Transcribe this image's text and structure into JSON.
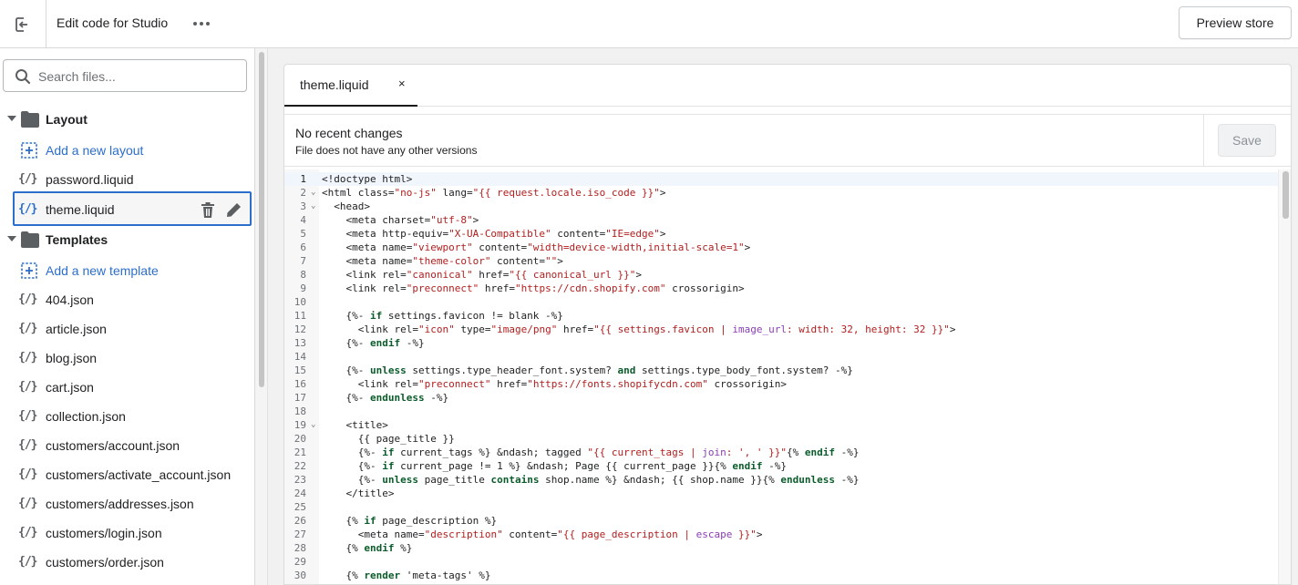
{
  "topbar": {
    "title": "Edit code for Studio",
    "preview_label": "Preview store",
    "more_label": "•••"
  },
  "sidebar": {
    "search_placeholder": "Search files...",
    "layout_folder": "Layout",
    "add_layout": "Add a new layout",
    "layout_files": [
      "password.liquid",
      "theme.liquid"
    ],
    "templates_folder": "Templates",
    "add_template": "Add a new template",
    "template_files": [
      "404.json",
      "article.json",
      "blog.json",
      "cart.json",
      "collection.json",
      "customers/account.json",
      "customers/activate_account.json",
      "customers/addresses.json",
      "customers/login.json",
      "customers/order.json"
    ],
    "file_icon_text": "{/}"
  },
  "editor": {
    "tab_label": "theme.liquid",
    "tab_close": "×",
    "info_title": "No recent changes",
    "info_sub": "File does not have any other versions",
    "save_label": "Save"
  }
}
